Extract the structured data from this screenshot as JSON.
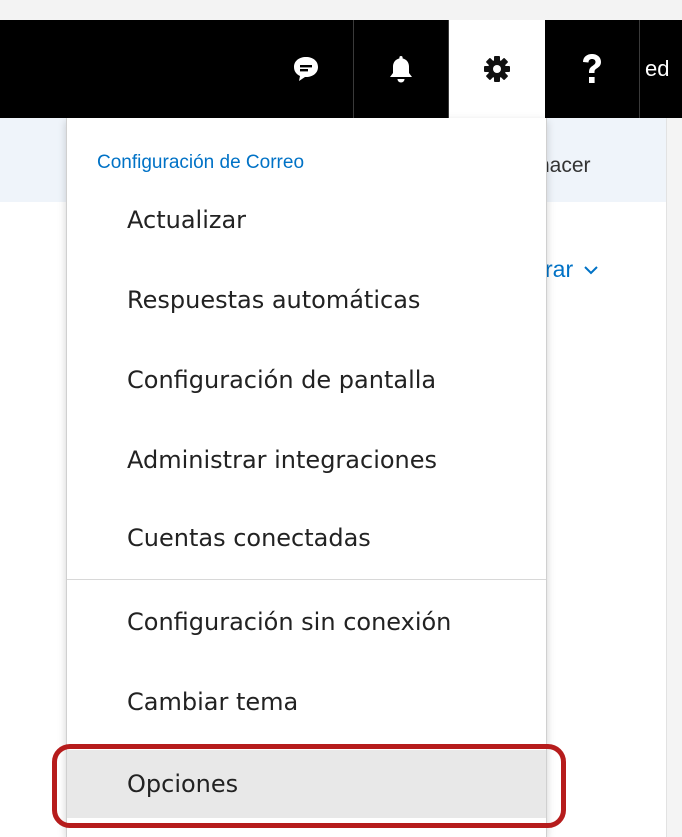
{
  "header": {
    "user_label": "ed",
    "icons": [
      "chat-icon",
      "bell-icon",
      "gear-icon",
      "help-icon"
    ]
  },
  "background": {
    "undo_label": "hacer",
    "filter_label": "rar"
  },
  "menu": {
    "title": "Configuración de Correo",
    "items": [
      {
        "label": "Actualizar"
      },
      {
        "label": "Respuestas automáticas"
      },
      {
        "label": "Configuración de pantalla"
      },
      {
        "label": "Administrar integraciones"
      },
      {
        "label": "Cuentas conectadas"
      },
      {
        "label": "Configuración sin conexión"
      },
      {
        "label": "Cambiar tema"
      },
      {
        "label": "Opciones",
        "selected": true
      }
    ]
  },
  "colors": {
    "accent": "#0072c6",
    "highlight": "#b61c1c",
    "topbar": "#000000"
  }
}
